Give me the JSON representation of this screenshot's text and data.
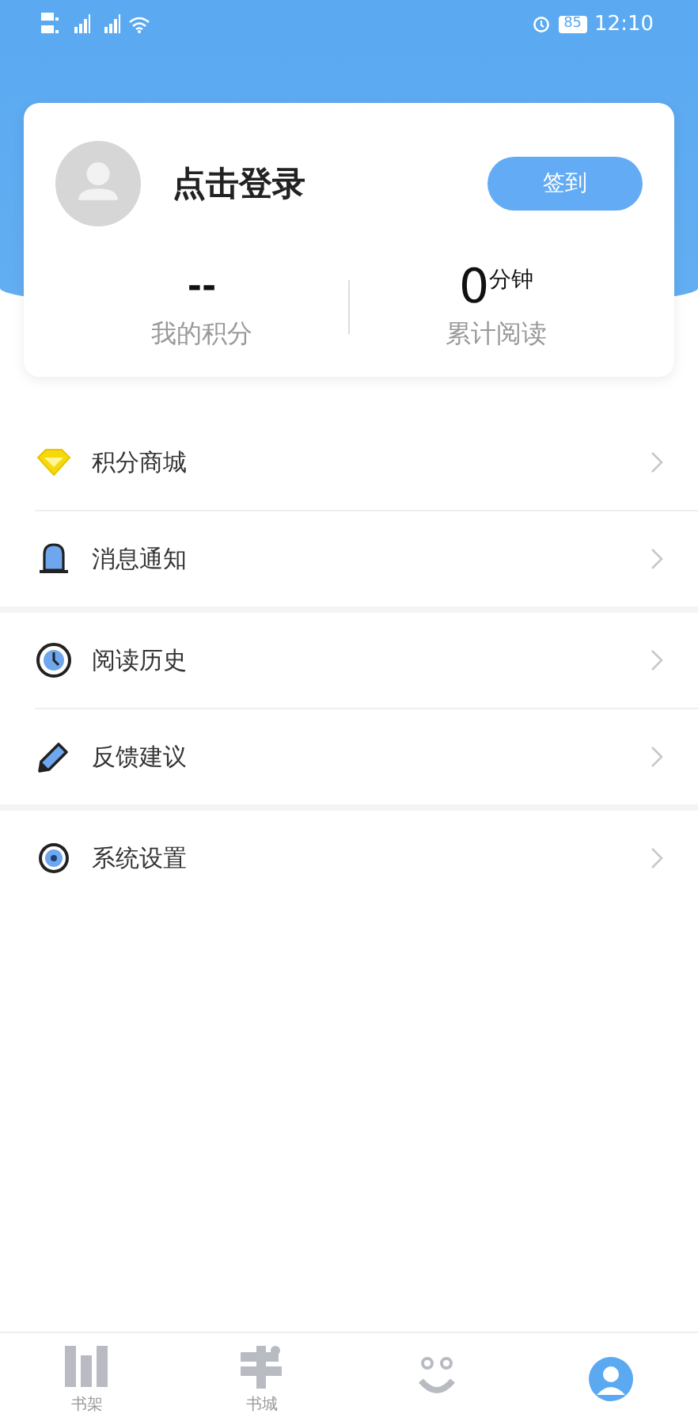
{
  "status_bar": {
    "battery": "85",
    "time": "12:10"
  },
  "profile": {
    "login": "点击登录",
    "checkin_button": "签到"
  },
  "stats": [
    {
      "value": "--",
      "label": "我的积分"
    },
    {
      "value": "0",
      "unit": "分钟",
      "label": "累计阅读"
    }
  ],
  "menu_groups": [
    [
      {
        "label": "积分商城"
      },
      {
        "label": "消息通知"
      }
    ],
    [
      {
        "label": "阅读历史"
      },
      {
        "label": "反馈建议"
      }
    ],
    [
      {
        "label": "系统设置"
      }
    ]
  ],
  "bottom_nav": [
    {
      "label": "书架",
      "selected": false
    },
    {
      "label": "书城",
      "selected": false
    },
    {
      "selected": false
    },
    {
      "selected": true
    }
  ]
}
